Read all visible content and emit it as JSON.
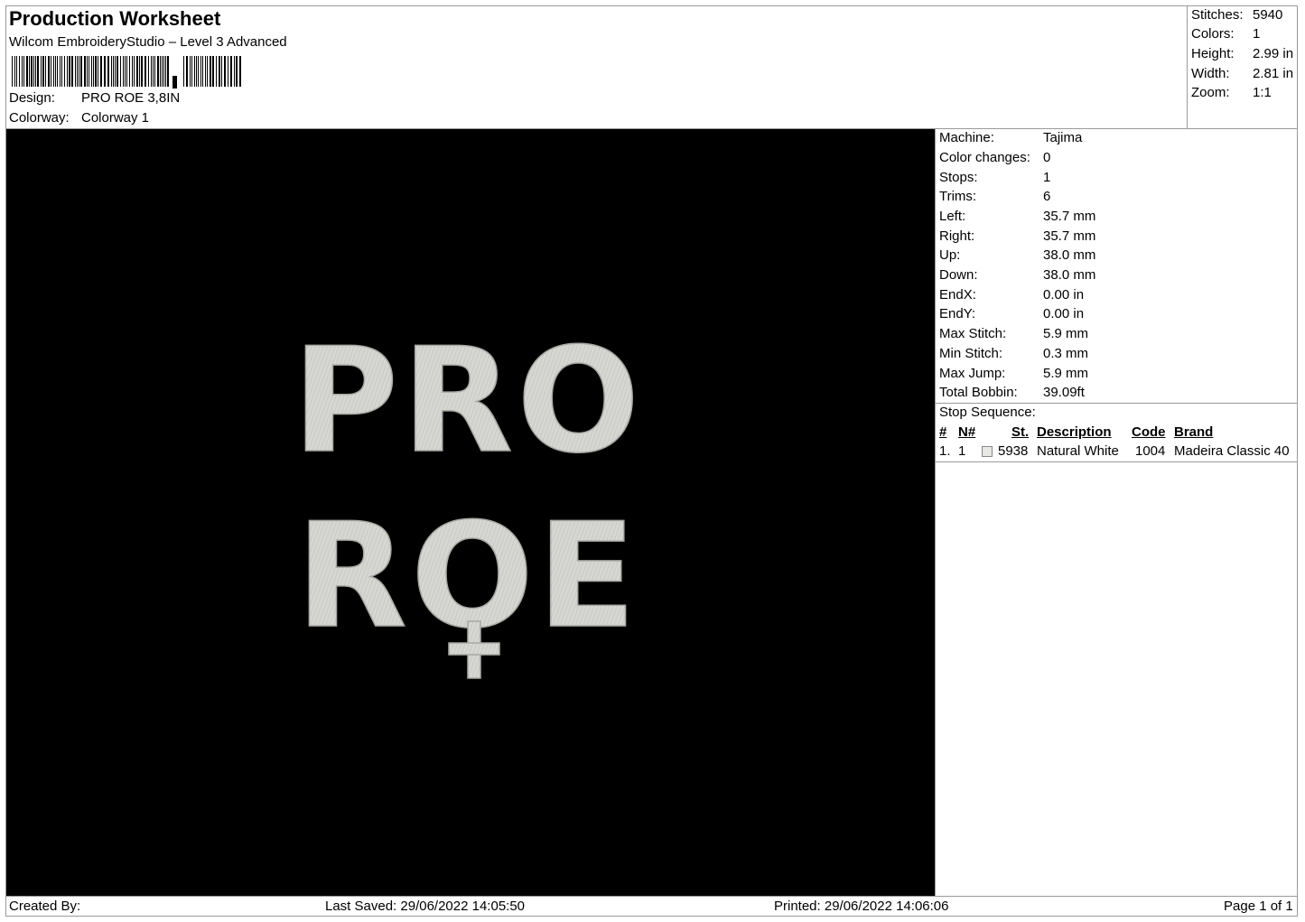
{
  "header": {
    "title": "Production Worksheet",
    "subtitle": "Wilcom EmbroideryStudio – Level 3 Advanced",
    "design_label": "Design:",
    "design_value": "PRO ROE 3,8IN",
    "colorway_label": "Colorway:",
    "colorway_value": "Colorway 1"
  },
  "stats": {
    "stitches_label": "Stitches:",
    "stitches_value": "5940",
    "colors_label": "Colors:",
    "colors_value": "1",
    "height_label": "Height:",
    "height_value": "2.99 in",
    "width_label": "Width:",
    "width_value": "2.81 in",
    "zoom_label": "Zoom:",
    "zoom_value": "1:1"
  },
  "preview": {
    "line1": "PRO",
    "line2": "ROE",
    "background": "#000000",
    "thread_color": "#d6d6d2"
  },
  "machine_info": [
    {
      "label": "Machine:",
      "value": "Tajima"
    },
    {
      "label": "Color changes:",
      "value": "0"
    },
    {
      "label": "Stops:",
      "value": "1"
    },
    {
      "label": "Trims:",
      "value": "6"
    },
    {
      "label": "Left:",
      "value": "35.7 mm"
    },
    {
      "label": "Right:",
      "value": "35.7 mm"
    },
    {
      "label": "Up:",
      "value": "38.0 mm"
    },
    {
      "label": "Down:",
      "value": "38.0 mm"
    },
    {
      "label": "EndX:",
      "value": "0.00 in"
    },
    {
      "label": "EndY:",
      "value": "0.00 in"
    },
    {
      "label": "Max Stitch:",
      "value": "5.9 mm"
    },
    {
      "label": "Min Stitch:",
      "value": "0.3 mm"
    },
    {
      "label": "Max Jump:",
      "value": "5.9 mm"
    },
    {
      "label": "Total Bobbin:",
      "value": "39.09ft"
    }
  ],
  "stop_sequence": {
    "title": "Stop Sequence:",
    "headers": {
      "num": "#",
      "n": "N#",
      "st": "St.",
      "description": "Description",
      "code": "Code",
      "brand": "Brand"
    },
    "rows": [
      {
        "num": "1.",
        "n": "1",
        "swatch": "#e8e8e4",
        "st": "5938",
        "description": "Natural White",
        "code": "1004",
        "brand": "Madeira Classic 40"
      }
    ]
  },
  "footer": {
    "created_by": "Created By:",
    "last_saved": "Last Saved: 29/06/2022 14:05:50",
    "printed": "Printed: 29/06/2022 14:06:06",
    "page": "Page 1 of 1"
  }
}
